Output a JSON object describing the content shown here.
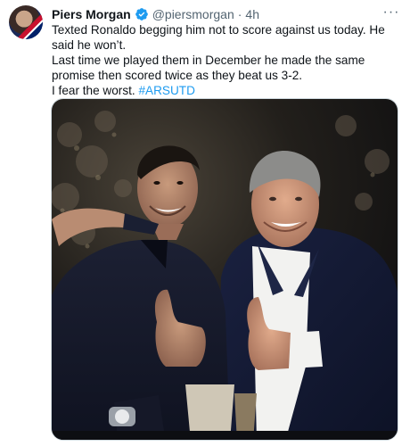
{
  "tweet": {
    "author_name": "Piers Morgan",
    "handle": "@piersmorgan",
    "separator": "·",
    "time": "4h",
    "more_label": "···",
    "line1": "Texted Ronaldo begging him not to score against us today. He said he won’t.",
    "line2": "Last time we played them in December he made the same promise then scored twice as they beat us 3-2.",
    "line3_text": "I fear the worst. ",
    "hashtag": "#ARSUTD"
  },
  "colors": {
    "verified": "#1d9bf0",
    "hashtag": "#1d9bf0",
    "muted": "#536471"
  },
  "icons": {
    "verified": "verified-badge-icon",
    "more": "more-options-icon"
  }
}
